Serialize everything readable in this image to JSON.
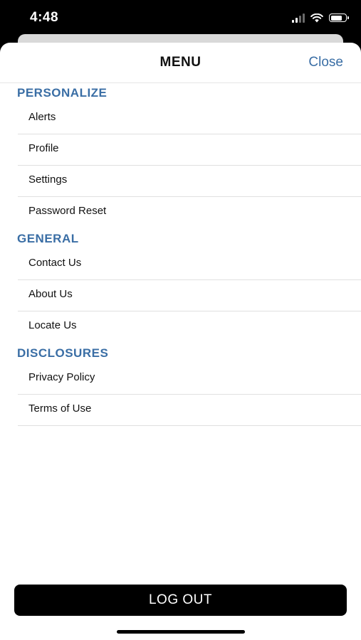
{
  "status_bar": {
    "time": "4:48",
    "icons": [
      "signal-icon",
      "wifi-icon",
      "battery-icon"
    ]
  },
  "header": {
    "title": "MENU",
    "close_label": "Close"
  },
  "sections": [
    {
      "title": "PERSONALIZE",
      "items": [
        "Alerts",
        "Profile",
        "Settings",
        "Password Reset"
      ]
    },
    {
      "title": "GENERAL",
      "items": [
        "Contact Us",
        "About Us",
        "Locate Us"
      ]
    },
    {
      "title": "DISCLOSURES",
      "items": [
        "Privacy Policy",
        "Terms of Use"
      ]
    }
  ],
  "logout_label": "LOG OUT",
  "colors": {
    "accent": "#3a6ea5",
    "button": "#000000",
    "divider": "#e0e0e0"
  }
}
